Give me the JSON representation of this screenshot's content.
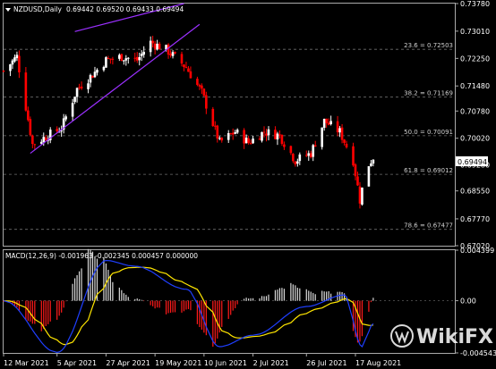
{
  "main_chart": {
    "header": {
      "symbol": "NZDUSD,Daily",
      "ohlc": "0.69442 0.69520 0.69433 0.69494"
    },
    "last_price": "0.69494",
    "y_ticks": [
      "0.73780",
      "0.73010",
      "0.72250",
      "0.71480",
      "0.70780",
      "0.70020",
      "0.69280",
      "0.68550",
      "0.67770",
      "0.67020"
    ],
    "fib_levels": [
      {
        "label": "23.6 = 0.72503",
        "value": 0.72503
      },
      {
        "label": "38.2 = 0.71169",
        "value": 0.71169
      },
      {
        "label": "50.0 = 0.70091",
        "value": 0.70091
      },
      {
        "label": "61.8 = 0.69012",
        "value": 0.69012
      },
      {
        "label": "78.6 = 0.67477",
        "value": 0.67477
      }
    ]
  },
  "macd_panel": {
    "header": "MACD(12,26,9) -0.001963 -0.002345 0.000457 0.000000",
    "y_ticks": [
      "0.004399",
      "0.00",
      "-0.004543"
    ]
  },
  "x_axis": {
    "labels": [
      "12 Mar 2021",
      "5 Apr 2021",
      "27 Apr 2021",
      "19 May 2021",
      "10 Jun 2021",
      "2 Jul 2021",
      "26 Jul 2021",
      "17 Aug 2021"
    ]
  },
  "watermark": "WikiFX",
  "colors": {
    "background": "#000000",
    "bull_candle": "#ffffff",
    "bear_candle": "#ff0000",
    "grid": "#6e6e6e",
    "channel": "#9b30ff",
    "macd_hist_pos": "#d9d9d9",
    "macd_hist_neg": "#ff1a1a",
    "macd_line": "#1f3fff",
    "signal_line": "#ffe600"
  },
  "chart_data": {
    "type": "candlestick",
    "title": "NZDUSD,Daily",
    "x_start": "12 Mar 2021",
    "x_end": "25 Aug 2021",
    "ylim": [
      0.6702,
      0.7378
    ],
    "close_path": [
      {
        "date": "12 Mar 2021",
        "close": 0.719
      },
      {
        "date": "18 Mar 2021",
        "close": 0.723
      },
      {
        "date": "25 Mar 2021",
        "close": 0.6985
      },
      {
        "date": "1 Apr 2021",
        "close": 0.701
      },
      {
        "date": "7 Apr 2021",
        "close": 0.703
      },
      {
        "date": "14 Apr 2021",
        "close": 0.714
      },
      {
        "date": "21 Apr 2021",
        "close": 0.718
      },
      {
        "date": "27 Apr 2021",
        "close": 0.722
      },
      {
        "date": "4 May 2021",
        "close": 0.723
      },
      {
        "date": "11 May 2021",
        "close": 0.722
      },
      {
        "date": "17 May 2021",
        "close": 0.727
      },
      {
        "date": "24 May 2021",
        "close": 0.725
      },
      {
        "date": "2 Jun 2021",
        "close": 0.72
      },
      {
        "date": "9 Jun 2021",
        "close": 0.713
      },
      {
        "date": "17 Jun 2021",
        "close": 0.699
      },
      {
        "date": "24 Jun 2021",
        "close": 0.702
      },
      {
        "date": "30 Jun 2021",
        "close": 0.699
      },
      {
        "date": "7 Jul 2021",
        "close": 0.702
      },
      {
        "date": "14 Jul 2021",
        "close": 0.701
      },
      {
        "date": "21 Jul 2021",
        "close": 0.694
      },
      {
        "date": "28 Jul 2021",
        "close": 0.696
      },
      {
        "date": "3 Aug 2021",
        "close": 0.705
      },
      {
        "date": "10 Aug 2021",
        "close": 0.702
      },
      {
        "date": "16 Aug 2021",
        "close": 0.694
      },
      {
        "date": "19 Aug 2021",
        "close": 0.683
      },
      {
        "date": "22 Aug 2021",
        "close": 0.692
      },
      {
        "date": "25 Aug 2021",
        "close": 0.6949
      }
    ],
    "channel_lines": [
      {
        "from": {
          "date": "24 Mar 2021",
          "price": 0.696
        },
        "to": {
          "date": "8 Jun 2021",
          "price": 0.732
        }
      },
      {
        "from": {
          "date": "13 Apr 2021",
          "price": 0.73
        },
        "to": {
          "date": "1 Jun 2021",
          "price": 0.7378
        }
      }
    ],
    "macd_path": [
      {
        "date": "12 Mar 2021",
        "value": 0.0
      },
      {
        "date": "5 Apr 2021",
        "value": -0.0045
      },
      {
        "date": "27 Apr 2021",
        "value": 0.0035
      },
      {
        "date": "10 May 2021",
        "value": 0.003
      },
      {
        "date": "2 Jun 2021",
        "value": 0.001
      },
      {
        "date": "17 Jun 2021",
        "value": -0.004
      },
      {
        "date": "2 Jul 2021",
        "value": -0.003
      },
      {
        "date": "26 Jul 2021",
        "value": -0.0005
      },
      {
        "date": "12 Aug 2021",
        "value": 0.0005
      },
      {
        "date": "20 Aug 2021",
        "value": -0.004
      },
      {
        "date": "25 Aug 2021",
        "value": -0.002
      }
    ],
    "grid": true
  }
}
